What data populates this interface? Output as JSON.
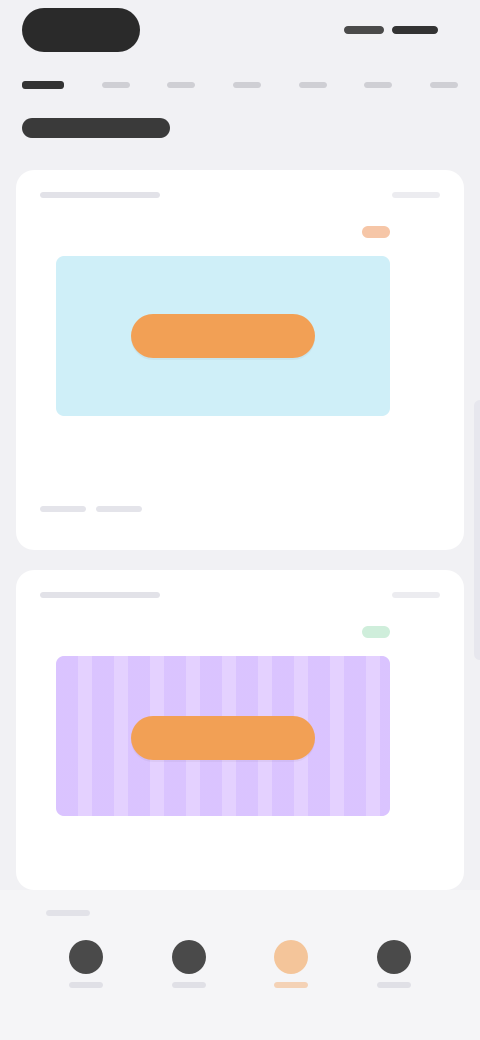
{
  "topbar": {
    "app_name": "",
    "right_status": ""
  },
  "tabs": [
    {
      "label": ""
    },
    {
      "label": ""
    },
    {
      "label": ""
    },
    {
      "label": ""
    },
    {
      "label": ""
    },
    {
      "label": ""
    },
    {
      "label": ""
    }
  ],
  "section": {
    "title": ""
  },
  "cards": [
    {
      "header_left": "",
      "header_right": "",
      "badge": "",
      "cta": "",
      "footer": ""
    },
    {
      "header_left": "",
      "header_right": "",
      "badge": "",
      "cta": "",
      "footer": ""
    }
  ],
  "bottom_nav": {
    "items": [
      {
        "label": "",
        "icon": "home-icon"
      },
      {
        "label": "",
        "icon": "discover-icon"
      },
      {
        "label": "",
        "icon": "create-icon"
      },
      {
        "label": "",
        "icon": "profile-icon"
      }
    ],
    "active_index": 2
  },
  "colors": {
    "background": "#f1f1f4",
    "card": "#ffffff",
    "cta_orange": "#f2a055",
    "blue_banner": "#cfeff8",
    "purple_banner": "#e4d1ff"
  }
}
